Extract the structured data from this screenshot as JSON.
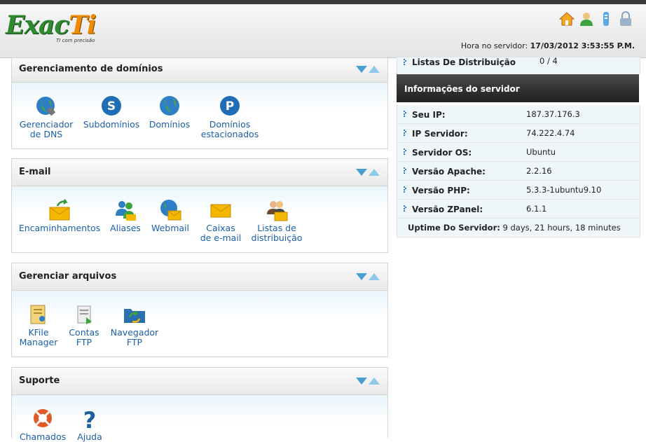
{
  "header": {
    "logo_text": "Exac",
    "logo_ti": "Ti",
    "logo_tagline": "TI com precisão",
    "server_time_label": "Hora no servidor: ",
    "server_time_value": "17/03/2012 3:53:55 P.M.",
    "icons": [
      "home-icon",
      "user-icon",
      "key-icon",
      "lock-icon"
    ]
  },
  "domains": {
    "title": "Gerenciamento de domínios",
    "items": [
      {
        "l1": "Gerenciador",
        "l2": "de DNS",
        "icon": "dns-globe-icon"
      },
      {
        "l1": "Subdomínios",
        "l2": "",
        "icon": "subdomain-s-icon"
      },
      {
        "l1": "Domínios",
        "l2": "",
        "icon": "globe-icon"
      },
      {
        "l1": "Domínios",
        "l2": "estacionados",
        "icon": "parked-p-icon"
      }
    ]
  },
  "email": {
    "title": "E-mail",
    "items": [
      {
        "l1": "Encaminhamentos",
        "l2": "",
        "icon": "forward-mail-icon"
      },
      {
        "l1": "Aliases",
        "l2": "",
        "icon": "aliases-icon"
      },
      {
        "l1": "Webmail",
        "l2": "",
        "icon": "webmail-icon"
      },
      {
        "l1": "Caixas",
        "l2": "de e-mail",
        "icon": "mailbox-icon"
      },
      {
        "l1": "Listas de",
        "l2": "distribuição",
        "icon": "distribution-list-icon"
      }
    ]
  },
  "files": {
    "title": "Gerenciar arquivos",
    "items": [
      {
        "l1": "KFile",
        "l2": "Manager",
        "icon": "file-manager-icon"
      },
      {
        "l1": "Contas",
        "l2": "FTP",
        "icon": "ftp-accounts-icon"
      },
      {
        "l1": "Navegador",
        "l2": "FTP",
        "icon": "ftp-browser-icon"
      }
    ]
  },
  "support": {
    "title": "Suporte",
    "items": [
      {
        "l1": "Chamados",
        "l2": "",
        "icon": "lifebuoy-icon"
      },
      {
        "l1": "Ajuda",
        "l2": "",
        "icon": "question-icon"
      }
    ]
  },
  "right": {
    "dist_label": "Listas De Distribuição",
    "dist_value": "0 / 4",
    "server_info_title": "Informações do servidor",
    "rows": [
      {
        "k": "Seu IP:",
        "v": "187.37.176.3"
      },
      {
        "k": "IP Servidor:",
        "v": "74.222.4.74"
      },
      {
        "k": "Servidor OS:",
        "v": "Ubuntu"
      },
      {
        "k": "Versão Apache:",
        "v": "2.2.16"
      },
      {
        "k": "Versão PHP:",
        "v": "5.3.3-1ubuntu9.10"
      },
      {
        "k": "Versão ZPanel:",
        "v": "6.1.1"
      }
    ],
    "uptime_label": "Uptime Do Servidor:",
    "uptime_value": " 9 days, 21 hours, 18 minutes"
  }
}
